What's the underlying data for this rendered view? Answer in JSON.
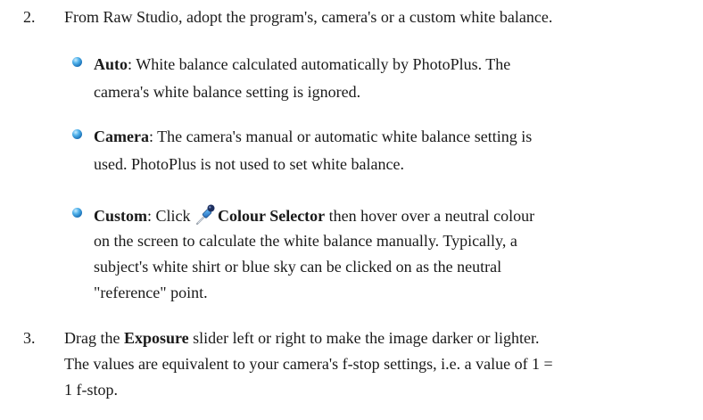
{
  "step2": {
    "number": "2.",
    "text": "From Raw Studio, adopt the program's, camera's or a custom white balance."
  },
  "bullets": {
    "auto": {
      "term": "Auto",
      "sep": ":",
      "line1_rest": " White balance calculated automatically by PhotoPlus. The",
      "line2": "camera's white balance setting is ignored."
    },
    "camera": {
      "term": "Camera",
      "sep": ":",
      "line1_rest": " The camera's manual or automatic white balance setting is",
      "line2": "used. PhotoPlus is not used to set white balance."
    },
    "custom": {
      "term": "Custom",
      "sep": ":",
      "click": " Click ",
      "icon": "colour-selector-icon",
      "tool": "Colour Selector",
      "line1_rest": " then hover over a neutral colour",
      "line2": "on the screen to calculate the white balance manually. Typically, a",
      "line3": "subject's white shirt or blue sky can be clicked on as the neutral",
      "line4": "\"reference\" point."
    }
  },
  "step3": {
    "number": "3.",
    "drag": "Drag the ",
    "exposure": "Exposure",
    "line1_rest": " slider left or right to make the image darker or lighter.",
    "line2": "The values are equivalent to your camera's f-stop settings, i.e. a value of 1 =",
    "line3": "1 f-stop."
  },
  "colors": {
    "text": "#1a1a1a",
    "bullet": "#1a6fb5"
  }
}
